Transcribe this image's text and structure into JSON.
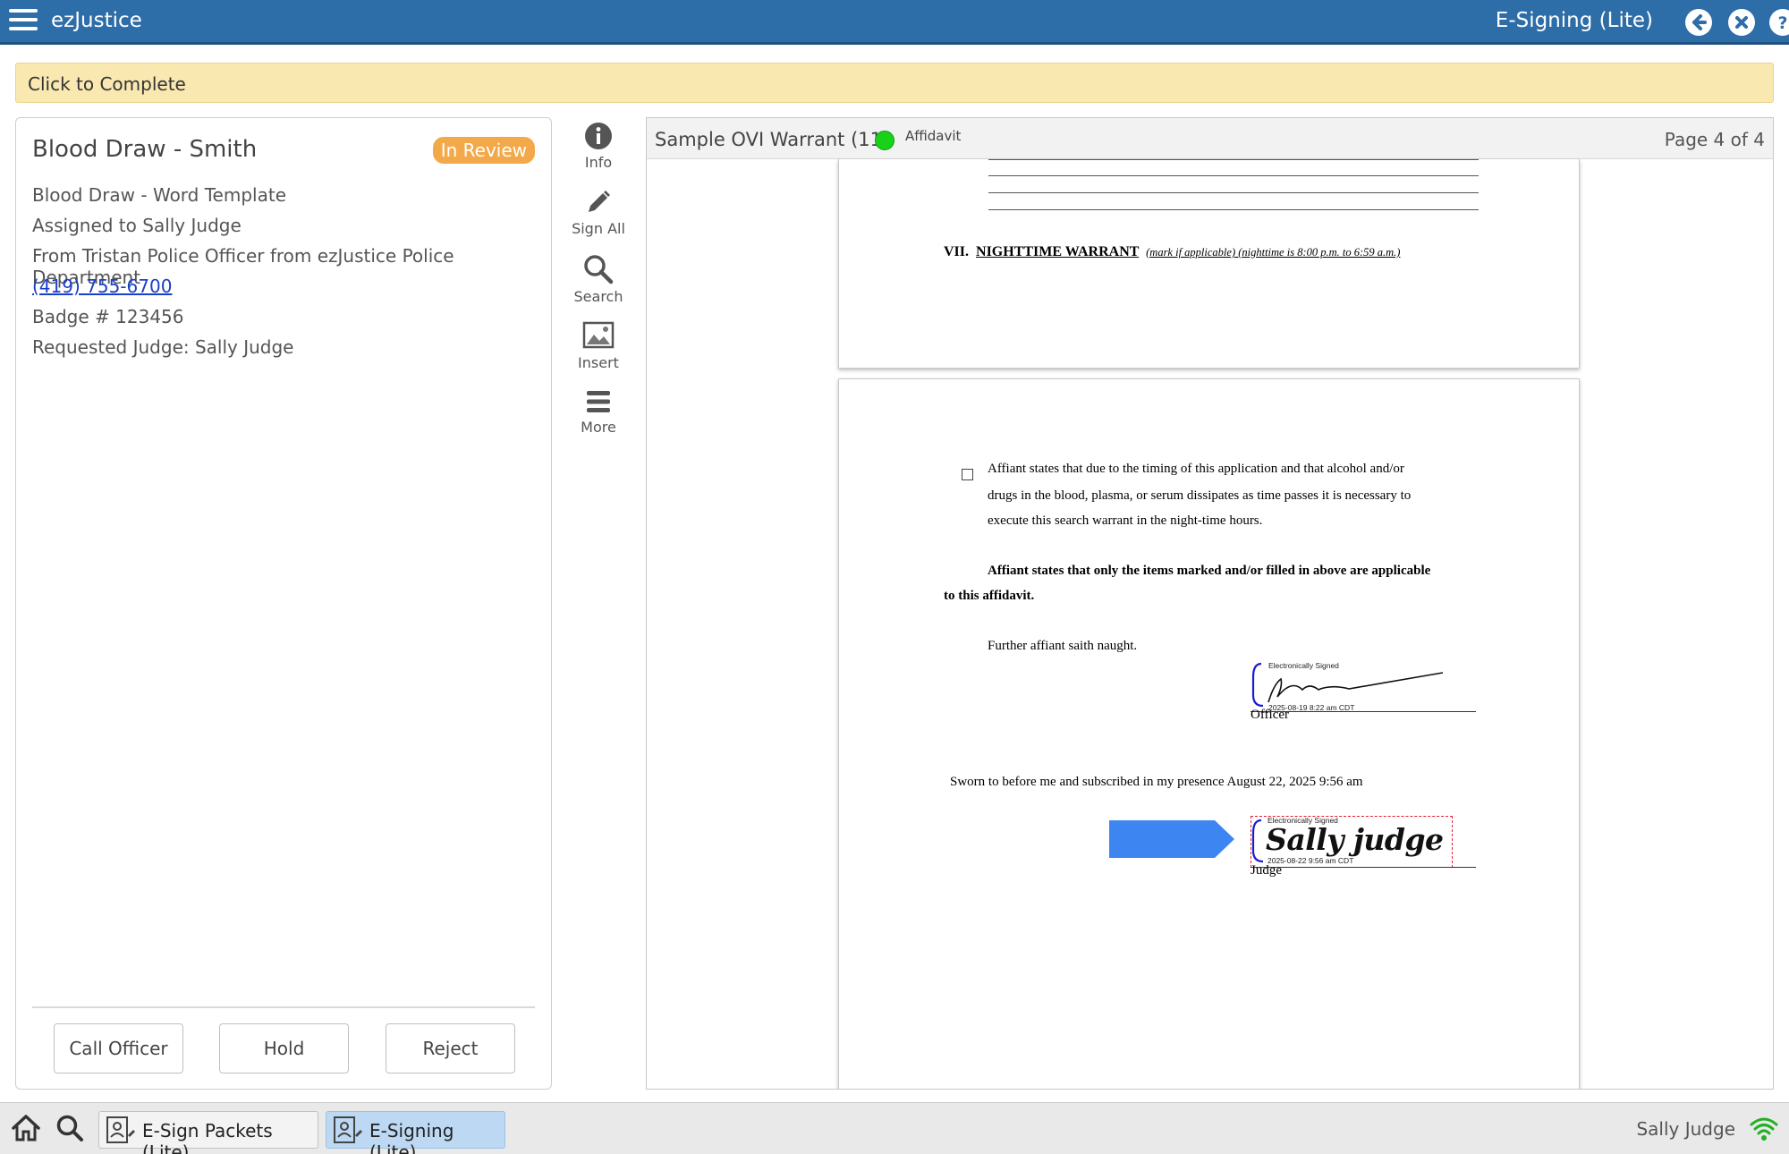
{
  "topbar": {
    "app_title": "ezJustice",
    "mode_title": "E-Signing (Lite)",
    "icons": [
      "menu-icon",
      "back-icon",
      "close-icon",
      "help-icon"
    ]
  },
  "complete_bar": {
    "label": "Click to Complete"
  },
  "left_panel": {
    "title": "Blood Draw - Smith",
    "status_badge": "In Review",
    "template": "Blood Draw - Word Template",
    "assigned": "Assigned to Sally Judge",
    "from": "From Tristan Police Officer from ezJustice Police Department",
    "phone": "(419) 755-6700",
    "badge_number": "Badge #  123456",
    "requested_judge": "Requested Judge:  Sally Judge",
    "buttons": {
      "call_officer": "Call Officer",
      "hold": "Hold",
      "reject": "Reject"
    }
  },
  "toolbar": {
    "info": "Info",
    "sign_all": "Sign All",
    "search": "Search",
    "insert": "Insert",
    "more": "More"
  },
  "viewer": {
    "doc_name": "Sample OVI Warrant (11)",
    "status_label": "Affidavit",
    "page_label": "Page 4 of 4",
    "status_color": "#19d119"
  },
  "page1": {
    "section_num": "VII.",
    "section_title": "NIGHTTIME WARRANT",
    "section_note": "(mark if applicable) (nighttime is 8:00 p.m. to 6:59 a.m.)"
  },
  "page2": {
    "checkbox_line1": "Affiant states that due to the timing of this application and that alcohol and/or",
    "checkbox_line2": "drugs in the blood, plasma, or serum dissipates as time passes it is necessary to",
    "checkbox_line3": "execute this search warrant in the night-time hours.",
    "bold_line1": "Affiant states that only the items marked and/or filled in above are applicable",
    "bold_line2": "to this affidavit.",
    "further": "Further affiant saith naught.",
    "officer_sig_header": "Electronically Signed",
    "officer_sig_date": "2025-08-19 8:22 am CDT",
    "officer_label": "Officer",
    "sworn": "Sworn to before me and subscribed in my presence August 22, 2025 9:56 am",
    "judge_sig_header": "Electronically Signed",
    "judge_sig_name": "Sally judge",
    "judge_sig_date": "2025-08-22 9:56 am CDT",
    "judge_label": "Judge",
    "arrow_color": "#3d85f0"
  },
  "bottombar": {
    "tasks": [
      {
        "label": "E-Sign Packets (Lite)"
      },
      {
        "label": "E-Signing (Lite)"
      }
    ],
    "user_name": "Sally Judge",
    "wifi_color": "#22b022"
  }
}
